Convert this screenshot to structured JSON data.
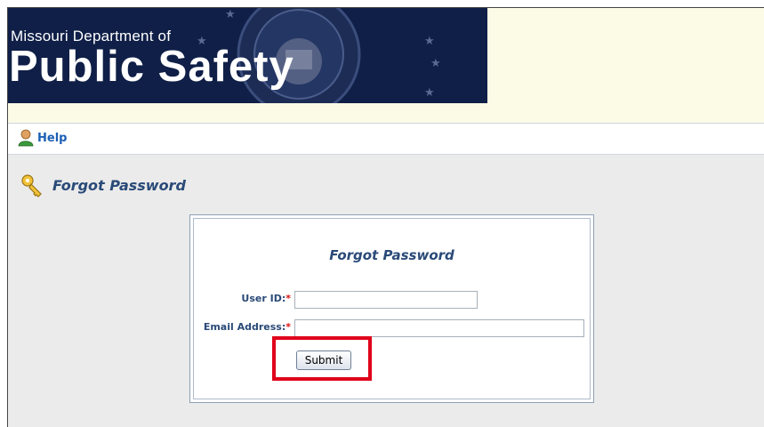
{
  "header": {
    "banner_line1": "Missouri Department of",
    "banner_line2": "Public Safety",
    "colors": {
      "banner": "#0f1f47",
      "header_bg": "#fbfbe6"
    }
  },
  "helpbar": {
    "help_label": "Help",
    "icon": "person-help-icon"
  },
  "section": {
    "title": "Forgot Password",
    "icon": "key-icon"
  },
  "form": {
    "title": "Forgot Password",
    "user_id_label": "User ID:",
    "email_label": "Email Address:",
    "required_marker": "*",
    "user_id_value": "",
    "email_value": "",
    "submit_label": "Submit"
  },
  "colors": {
    "accent_text": "#2a4a78",
    "link": "#1a5fb4",
    "required": "#dd1111",
    "highlight": "#e0001a"
  }
}
